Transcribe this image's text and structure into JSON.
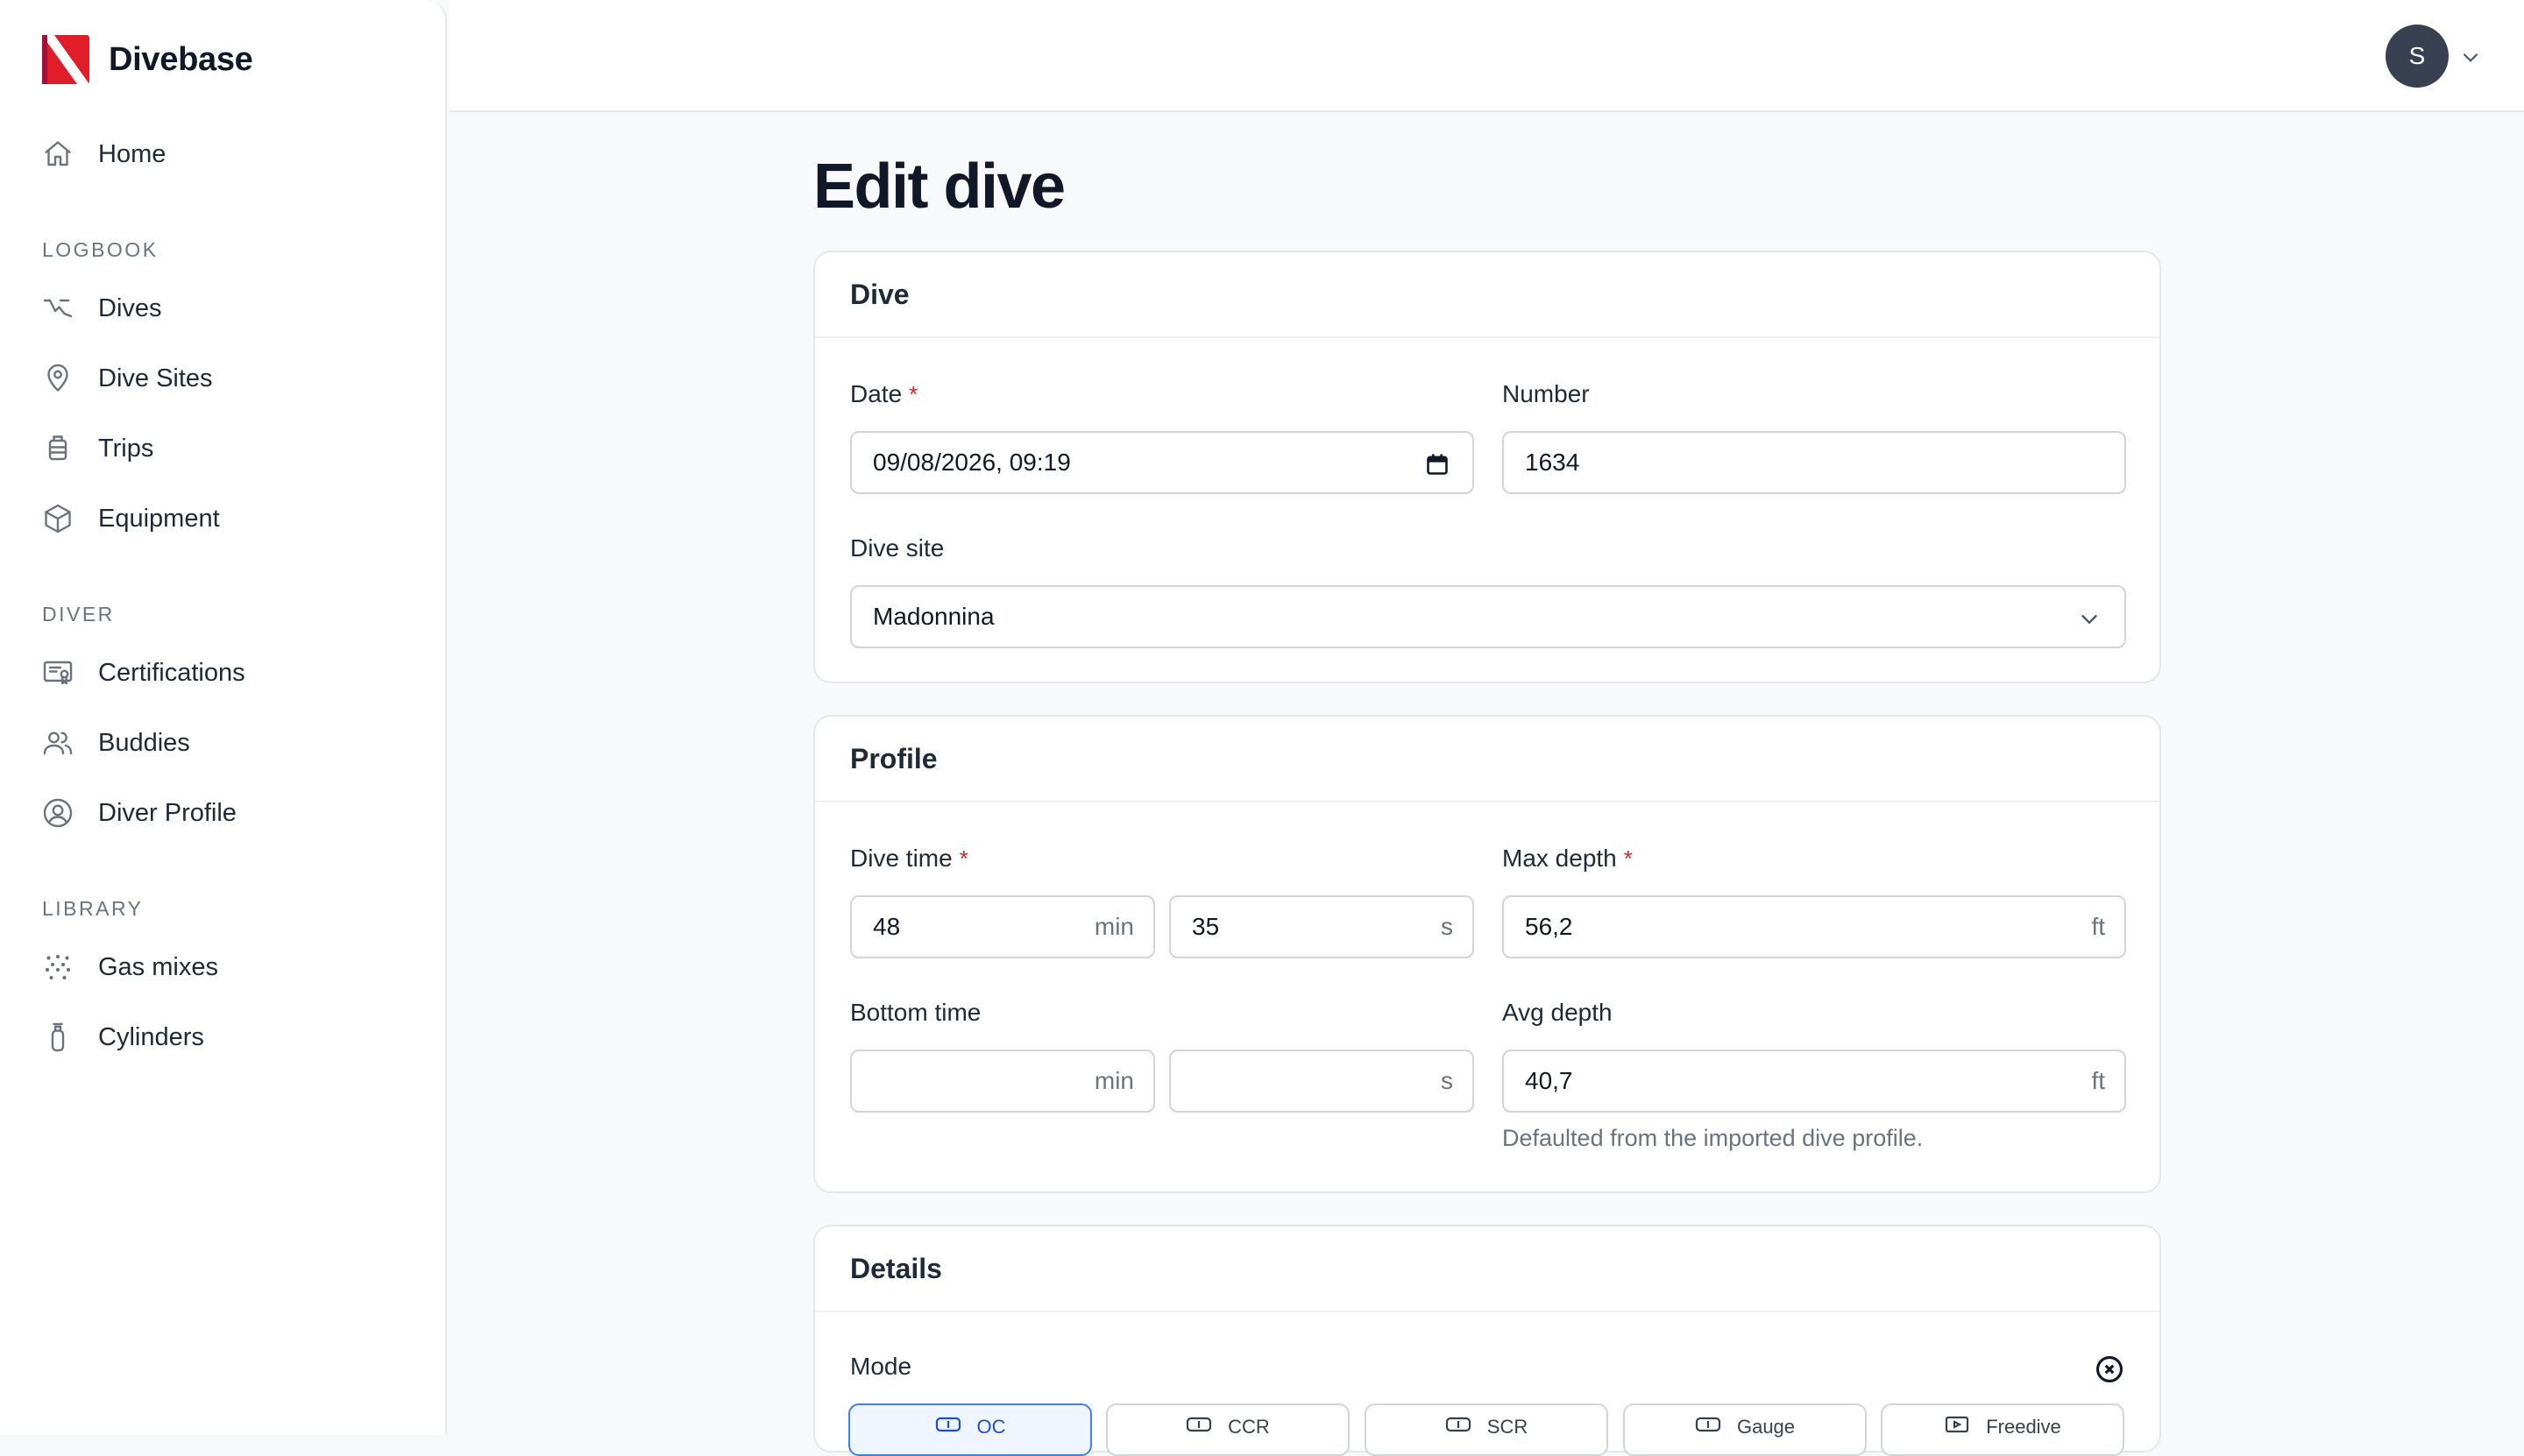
{
  "brand": {
    "name": "Divebase"
  },
  "sidebar": {
    "home": {
      "label": "Home",
      "icon": "home-icon"
    },
    "sections": [
      {
        "label": "LOGBOOK",
        "items": [
          {
            "label": "Dives",
            "icon": "dive-profile-icon"
          },
          {
            "label": "Dive Sites",
            "icon": "map-pin-icon"
          },
          {
            "label": "Trips",
            "icon": "luggage-icon"
          },
          {
            "label": "Equipment",
            "icon": "box-icon"
          }
        ]
      },
      {
        "label": "DIVER",
        "items": [
          {
            "label": "Certifications",
            "icon": "certificate-icon"
          },
          {
            "label": "Buddies",
            "icon": "users-icon"
          },
          {
            "label": "Diver Profile",
            "icon": "user-circle-icon"
          }
        ]
      },
      {
        "label": "LIBRARY",
        "items": [
          {
            "label": "Gas mixes",
            "icon": "dots-grid-icon"
          },
          {
            "label": "Cylinders",
            "icon": "cylinder-icon"
          }
        ]
      }
    ]
  },
  "header": {
    "avatar_initial": "S"
  },
  "page": {
    "title": "Edit dive"
  },
  "dive_card": {
    "title": "Dive",
    "date": {
      "label": "Date",
      "required_mark": "*",
      "value": "09/08/2026, 09:19"
    },
    "number": {
      "label": "Number",
      "value": "1634"
    },
    "site": {
      "label": "Dive site",
      "value": "Madonnina"
    }
  },
  "profile_card": {
    "title": "Profile",
    "dive_time": {
      "label": "Dive time",
      "required_mark": "*",
      "minutes": "48",
      "seconds": "35",
      "min_unit": "min",
      "sec_unit": "s"
    },
    "max_depth": {
      "label": "Max depth",
      "required_mark": "*",
      "value": "56,2",
      "unit": "ft"
    },
    "bottom_time": {
      "label": "Bottom time",
      "minutes": "",
      "seconds": "",
      "min_unit": "min",
      "sec_unit": "s"
    },
    "avg_depth": {
      "label": "Avg depth",
      "value": "40,7",
      "unit": "ft",
      "hint": "Defaulted from the imported dive profile."
    }
  },
  "details_card": {
    "title": "Details",
    "mode": {
      "label": "Mode",
      "options": [
        "OC",
        "CCR",
        "SCR",
        "Gauge",
        "Freedive"
      ],
      "selected": "OC"
    }
  },
  "colors": {
    "brand_red": "#e11d2a",
    "accent_blue": "#3b82f6",
    "required_red": "#dc2626",
    "avatar_bg": "#374151"
  }
}
